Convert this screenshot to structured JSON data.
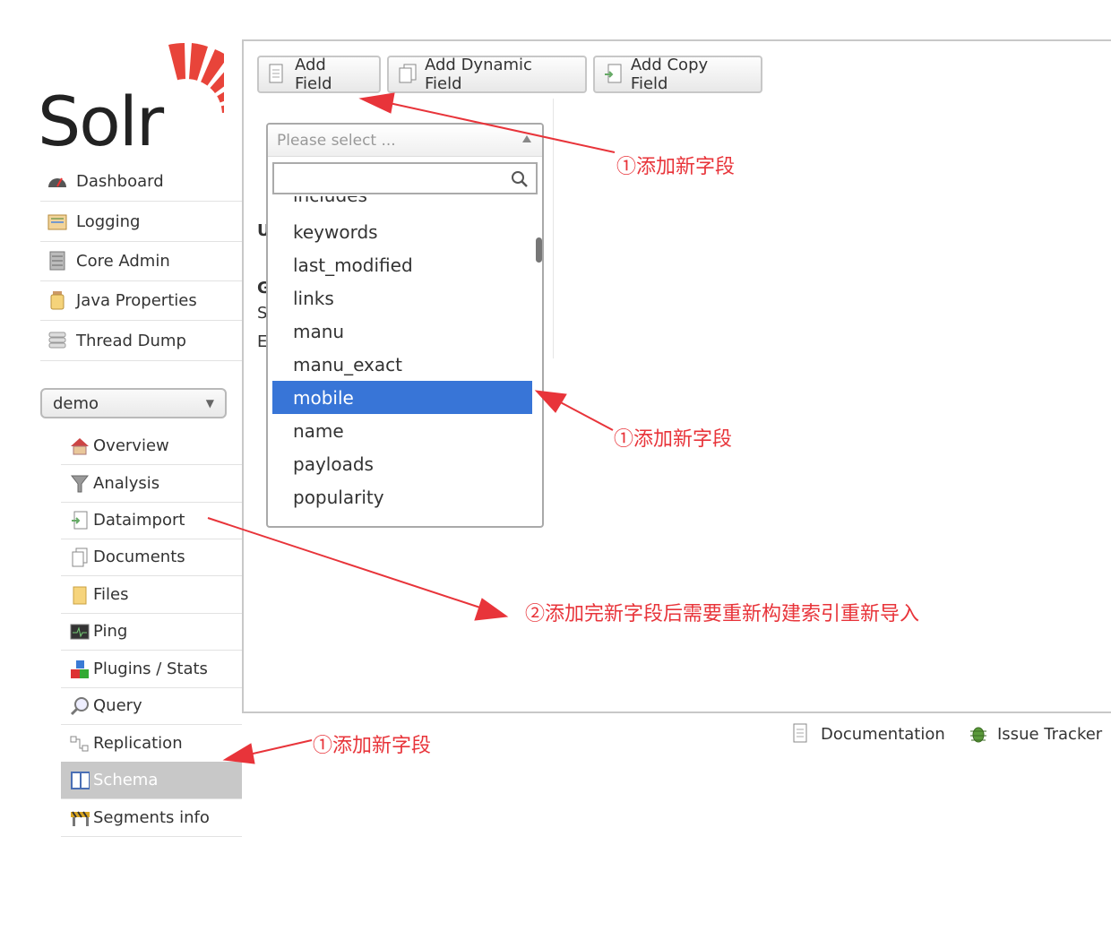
{
  "logo": {
    "text": "Solr"
  },
  "nav": [
    {
      "label": "Dashboard",
      "icon": "dashboard-icon"
    },
    {
      "label": "Logging",
      "icon": "logging-icon"
    },
    {
      "label": "Core Admin",
      "icon": "core-admin-icon"
    },
    {
      "label": "Java Properties",
      "icon": "java-properties-icon"
    },
    {
      "label": "Thread Dump",
      "icon": "thread-dump-icon"
    }
  ],
  "core_selector": {
    "value": "demo"
  },
  "core_menu": [
    {
      "label": "Overview",
      "icon": "home-icon"
    },
    {
      "label": "Analysis",
      "icon": "funnel-icon"
    },
    {
      "label": "Dataimport",
      "icon": "dataimport-icon"
    },
    {
      "label": "Documents",
      "icon": "documents-icon"
    },
    {
      "label": "Files",
      "icon": "folder-icon"
    },
    {
      "label": "Ping",
      "icon": "ping-icon"
    },
    {
      "label": "Plugins / Stats",
      "icon": "plugins-icon"
    },
    {
      "label": "Query",
      "icon": "magnifier-icon"
    },
    {
      "label": "Replication",
      "icon": "replication-icon"
    },
    {
      "label": "Schema",
      "icon": "schema-book-icon",
      "active": true
    },
    {
      "label": "Segments info",
      "icon": "segments-icon"
    }
  ],
  "toolbar": {
    "add_field": "Add Field",
    "add_dynamic_field": "Add Dynamic Field",
    "add_copy_field": "Add Copy Field"
  },
  "peek_letters": [
    "U",
    "G",
    "S",
    "E"
  ],
  "field_select": {
    "placeholder": "Please select ...",
    "search_value": "",
    "partial_top": "includes",
    "options": [
      "keywords",
      "last_modified",
      "links",
      "manu",
      "manu_exact",
      "mobile",
      "name",
      "payloads",
      "popularity"
    ],
    "selected": "mobile"
  },
  "footer": {
    "documentation": "Documentation",
    "issue_tracker": "Issue Tracker"
  },
  "annotations": {
    "a1": "①添加新字段",
    "a2": "①添加新字段",
    "a3": "②添加完新字段后需要重新构建索引重新导入",
    "a4": "①添加新字段"
  },
  "colors": {
    "accent": "#3875d7",
    "annotation": "#e8343a",
    "logo_red": "#e8443a"
  }
}
